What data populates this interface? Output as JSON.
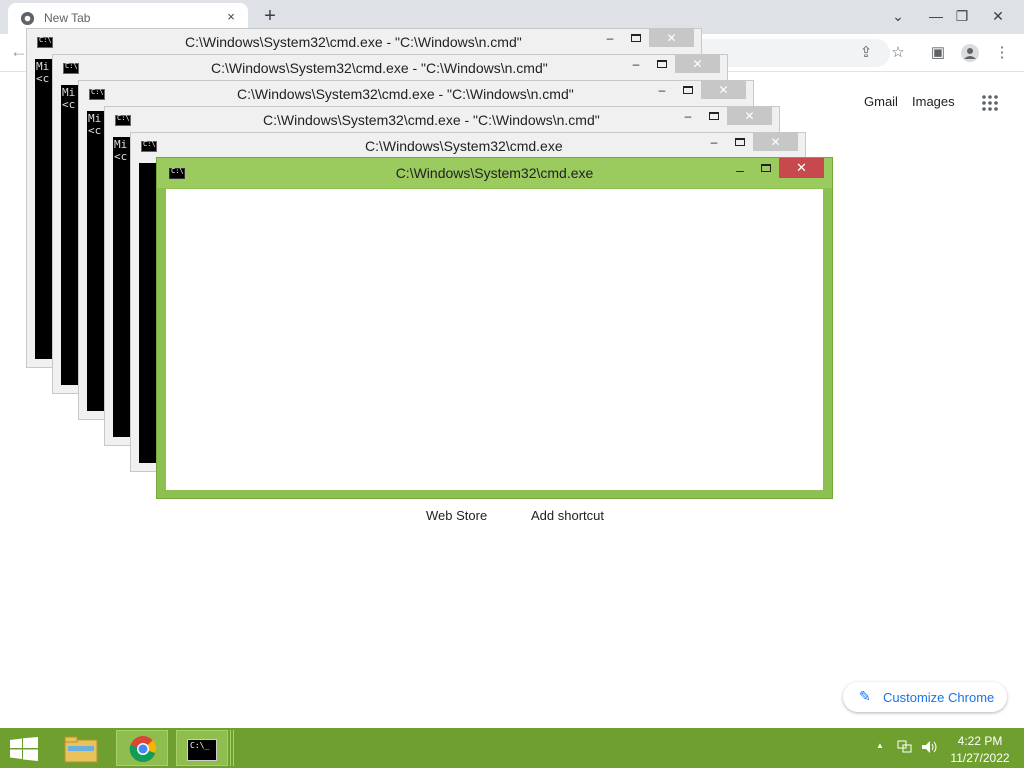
{
  "browser": {
    "tab_title": "New Tab",
    "tab_close": "×",
    "new_tab": "+",
    "window_controls": {
      "chevron": "⌄",
      "minimize": "—",
      "restore": "❐",
      "close": "✕"
    },
    "header_links": {
      "gmail": "Gmail",
      "images": "Images"
    },
    "shortcuts": {
      "web_store": "Web Store",
      "add_shortcut": "Add shortcut"
    },
    "customize_label": "Customize Chrome"
  },
  "cmd_windows": [
    {
      "title": "C:\\Windows\\System32\\cmd.exe - \"C:\\Windows\\n.cmd\"",
      "console": "Mi\n<c",
      "close": "✕"
    },
    {
      "title": "C:\\Windows\\System32\\cmd.exe - \"C:\\Windows\\n.cmd\"",
      "console": "Mi\n<c",
      "close": "✕"
    },
    {
      "title": "C:\\Windows\\System32\\cmd.exe - \"C:\\Windows\\n.cmd\"",
      "console": "Mi\n<c",
      "close": "✕"
    },
    {
      "title": "C:\\Windows\\System32\\cmd.exe - \"C:\\Windows\\n.cmd\"",
      "console": "Mi\n<c",
      "close": "✕"
    },
    {
      "title": "C:\\Windows\\System32\\cmd.exe",
      "console": "",
      "close": "✕"
    }
  ],
  "active_cmd": {
    "title": "C:\\Windows\\System32\\cmd.exe",
    "minimize": "–",
    "close": "✕"
  },
  "taskbar": {
    "apps": [
      "file-explorer",
      "chrome",
      "cmd"
    ],
    "clock_time": "4:22 PM",
    "clock_date": "11/27/2022",
    "accent_color": "#6fa02f"
  }
}
